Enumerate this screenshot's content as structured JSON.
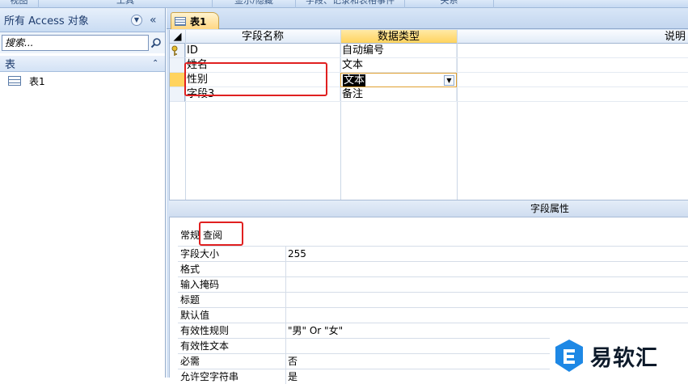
{
  "ribbon": {
    "groups": [
      "视图",
      "工具",
      "显示/隐藏",
      "字段、记录和表格事件",
      "关系"
    ]
  },
  "nav_pane": {
    "title": "所有 Access 对象",
    "search_placeholder": "搜索...",
    "group_label": "表",
    "items": [
      "表1"
    ]
  },
  "document": {
    "tab_label": "表1"
  },
  "design_grid": {
    "columns": [
      "字段名称",
      "数据类型",
      "说明"
    ],
    "rows": [
      {
        "name": "ID",
        "type": "自动编号",
        "key": true
      },
      {
        "name": "姓名",
        "type": "文本"
      },
      {
        "name": "性别",
        "type": "文本",
        "current": true
      },
      {
        "name": "字段3",
        "type": "备注"
      }
    ]
  },
  "field_properties": {
    "title": "字段属性",
    "tabs": [
      "常规",
      "查阅"
    ],
    "rows": [
      {
        "key": "字段大小",
        "value": "255"
      },
      {
        "key": "格式",
        "value": ""
      },
      {
        "key": "输入掩码",
        "value": ""
      },
      {
        "key": "标题",
        "value": ""
      },
      {
        "key": "默认值",
        "value": ""
      },
      {
        "key": "有效性规则",
        "value": "\"男\" Or \"女\""
      },
      {
        "key": "有效性文本",
        "value": ""
      },
      {
        "key": "必需",
        "value": "否"
      },
      {
        "key": "允许空字符串",
        "value": "是"
      }
    ]
  },
  "watermark": {
    "text": "易软汇"
  },
  "colors": {
    "accent": "#ffd35e",
    "annotation": "#e02020",
    "brand": "#1e88e5"
  }
}
